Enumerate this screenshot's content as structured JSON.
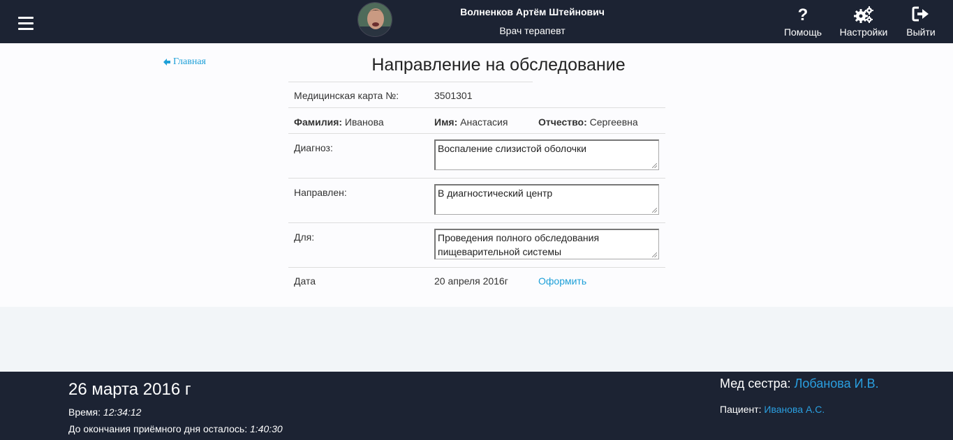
{
  "header": {
    "user_name": "Волненков Артём Штейнович",
    "user_role": "Врач терапевт",
    "nav": [
      {
        "label": "Помощь",
        "icon": "question-icon"
      },
      {
        "label": "Настройки",
        "icon": "gears-icon"
      },
      {
        "label": "Выйти",
        "icon": "sign-out-icon"
      }
    ]
  },
  "main": {
    "back_link": "Главная",
    "title": "Направление на обследование",
    "card_label": "Медицинская карта №:",
    "card_number": "3501301",
    "surname_label": "Фамилия:",
    "surname": "Иванова",
    "name_label": "Имя:",
    "name": "Анастасия",
    "patronymic_label": "Отчество:",
    "patronymic": "Сергеевна",
    "diagnosis_label": "Диагноз:",
    "diagnosis": "Воспаление слизистой оболочки",
    "referred_label": "Направлен:",
    "referred": "В диагностический центр",
    "purpose_label": "Для:",
    "purpose": "Проведения полного обследования пищеварительной системы",
    "date_label": "Дата",
    "date": "20 апреля 2016г",
    "submit_link": "Оформить"
  },
  "footer": {
    "date": "26 марта 2016 г",
    "time_label": "Время:",
    "time": "12:34:12",
    "remaining_label": "До окончания приёмного дня осталось:",
    "remaining": "1:40:30",
    "nurse_label": "Мед сестра:",
    "nurse": "Лобанова И.В.",
    "patient_label": "Пациент:",
    "patient": "Иванова А.С."
  },
  "colors": {
    "header_bg": "#1c2333",
    "link": "#1ea0d8",
    "footer_link": "#2a9fe0"
  }
}
